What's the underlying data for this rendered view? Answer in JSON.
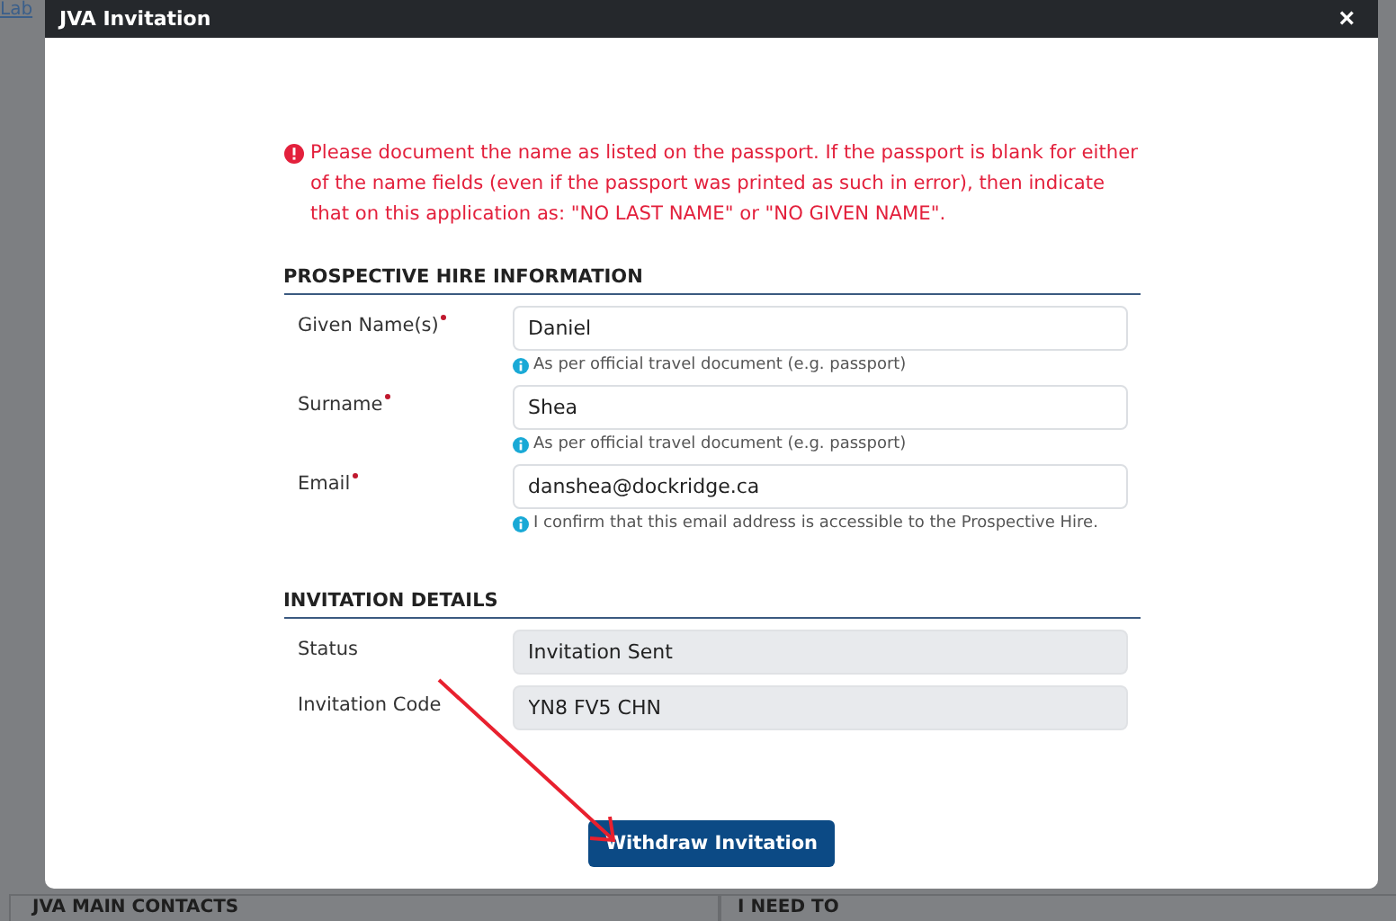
{
  "background": {
    "link": "Lab",
    "sections": [
      "JVA MAIN CONTACTS",
      "I NEED TO"
    ]
  },
  "dialog": {
    "title": "JVA Invitation",
    "close": "×",
    "notice": "Please document the name as listed on the passport. If the passport is blank for either of the name fields (even if the passport was printed as such in error), then indicate that on this application as: \"NO LAST NAME\" or \"NO GIVEN NAME\".",
    "sections": [
      {
        "heading": "PROSPECTIVE HIRE INFORMATION",
        "fields": [
          {
            "label": "Given Name(s)",
            "required": true,
            "value": "Daniel",
            "readonly": false,
            "hint": "As per official travel document (e.g. passport)"
          },
          {
            "label": "Surname",
            "required": true,
            "value": "Shea",
            "readonly": false,
            "hint": "As per official travel document (e.g. passport)"
          },
          {
            "label": "Email",
            "required": true,
            "value": "danshea@dockridge.ca",
            "readonly": false,
            "hint": "I confirm that this email address is accessible to the Prospective Hire."
          }
        ]
      },
      {
        "heading": "INVITATION DETAILS",
        "fields": [
          {
            "label": "Status",
            "required": false,
            "value": "Invitation Sent",
            "readonly": true
          },
          {
            "label": "Invitation Code",
            "required": false,
            "value": "YN8 FV5 CHN",
            "readonly": true
          }
        ]
      }
    ],
    "button": "Withdraw Invitation"
  }
}
